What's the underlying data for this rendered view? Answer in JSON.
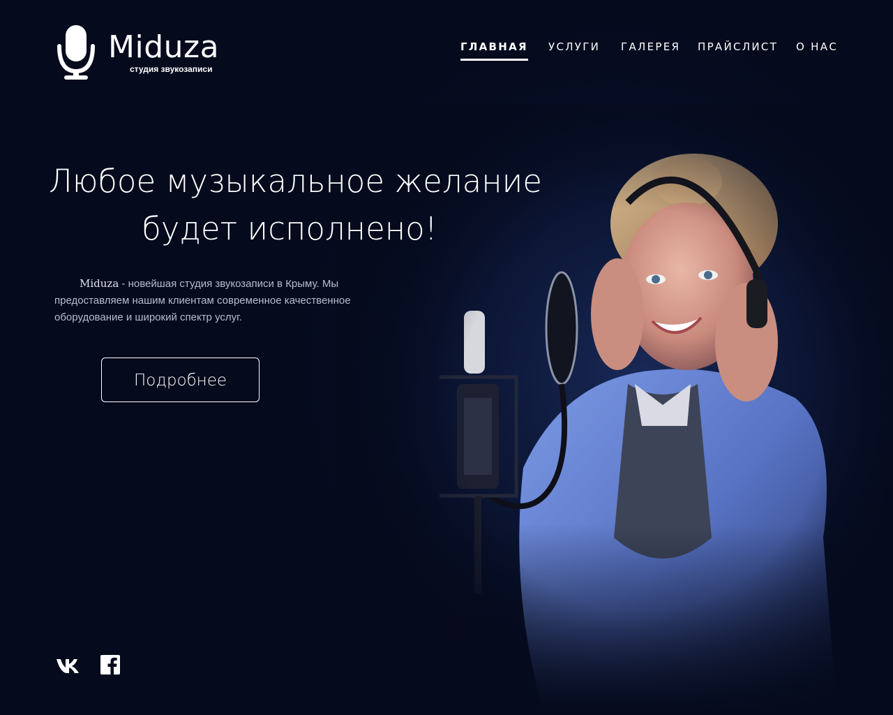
{
  "logo": {
    "name": "Miduza",
    "subtitle": "студия звукозаписи"
  },
  "nav": {
    "items": [
      {
        "label": "Главная",
        "active": true
      },
      {
        "label": "Услуги",
        "active": false
      },
      {
        "label": "Галерея",
        "active": false
      },
      {
        "label": "Прайслист",
        "active": false
      },
      {
        "label": "О нас",
        "active": false
      }
    ]
  },
  "hero": {
    "title_line1": "Любое музыкальное желание",
    "title_line2": "будет исполнено!",
    "desc_brand": "Miduza",
    "desc_text": " - новейшая студия звукозаписи в Крыму. Мы предоставляем нашим клиентам современное качественное оборудование и широкий спектр услуг.",
    "cta_label": "Подробнее"
  },
  "social": {
    "items": [
      {
        "icon": "vk-icon"
      },
      {
        "icon": "facebook-icon"
      }
    ]
  },
  "colors": {
    "background": "#050a1c",
    "text": "#ffffff",
    "muted_text": "#b8bed0",
    "accent_blue": "#6f8fe0"
  }
}
